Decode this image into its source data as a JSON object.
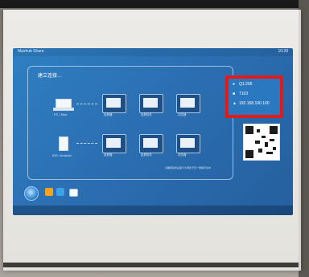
{
  "projection": {
    "app_name": "Maxhub Share",
    "clock": "10:28",
    "panel_title": "建立连接…",
    "sources": [
      {
        "label": "PC / Mac"
      },
      {
        "label": "iOS / Android"
      }
    ],
    "tiles": [
      {
        "label": "投屏器"
      },
      {
        "label": "投屏软件"
      },
      {
        "label": "浏览器"
      },
      {
        "label": "投屏器"
      },
      {
        "label": "投屏软件"
      },
      {
        "label": "浏览器"
      }
    ],
    "info": {
      "name": "Q1.206",
      "port": "7103",
      "ip": "192.168.100.100"
    },
    "footnote": "请确保您的设备与大屏处于同一网络环境中"
  },
  "highlight_color": "#e21a1a",
  "accent": "#2b6fb2"
}
